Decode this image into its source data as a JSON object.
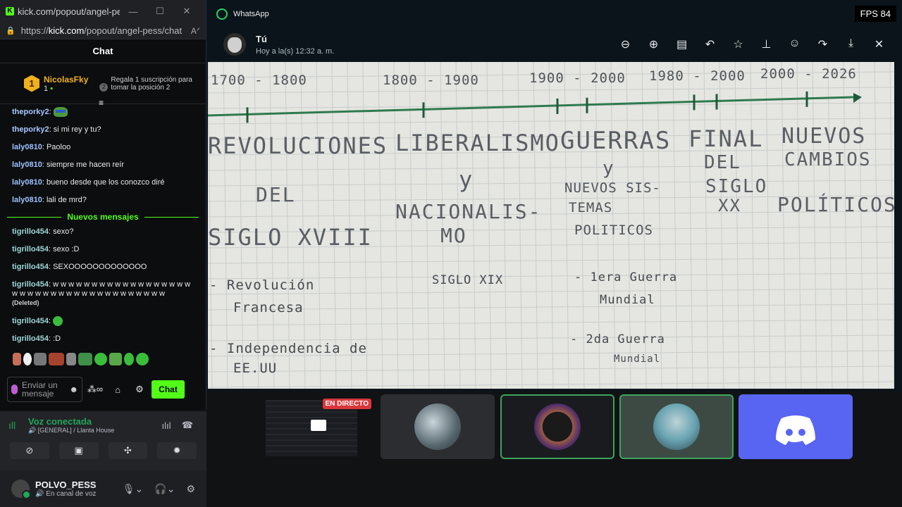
{
  "kick": {
    "tab_title": "kick.com/popout/angel-pes...",
    "url_prefix": "https://",
    "url_host": "kick.com",
    "url_path": "/popout/angel-pess/chat",
    "chat_header": "Chat",
    "top_gifter": {
      "rank": "1",
      "name": "NicolasFky",
      "count": "1"
    },
    "gift_promo": {
      "rank": "2",
      "text": "Regala 1 suscripción para tomar la posición 2"
    },
    "messages_before": [
      {
        "user": "theporky2",
        "text": "",
        "emote": "frog",
        "style": "porky"
      },
      {
        "user": "theporky2",
        "text": "si mi rey y tu?",
        "style": "porky"
      },
      {
        "user": "laly0810",
        "text": "Paoloo",
        "style": "laly"
      },
      {
        "user": "laly0810",
        "text": "siempre me hacen reír",
        "style": "laly"
      },
      {
        "user": "laly0810",
        "text": "bueno desde que los conozco diré",
        "style": "laly"
      },
      {
        "user": "laly0810",
        "text": "lali de mrd?",
        "style": "laly"
      }
    ],
    "new_messages_label": "Nuevos mensajes",
    "messages_after": [
      {
        "user": "tigrillo454",
        "text": "sexo?"
      },
      {
        "user": "tigrillo454",
        "text": "sexo :D"
      },
      {
        "user": "tigrillo454",
        "text": "SEXOOOOOOOOOOOOO"
      },
      {
        "user": "tigrillo454",
        "text": "w w w w w w w w w w w w w w w w w w w w w w w w w w w w w w w w w w w w w w",
        "deleted": "(Deleted)"
      },
      {
        "user": "tigrillo454",
        "text": "",
        "emote": "green"
      },
      {
        "user": "tigrillo454",
        "text": ":D"
      }
    ],
    "input_placeholder": "Enviar un mensaje",
    "chat_button": "Chat"
  },
  "discord": {
    "voice_status": "Voz conectada",
    "voice_channel": "[GENERAL] / Llanta House",
    "user_name": "POLVO_PESS",
    "user_status": "En canal de voz",
    "live_label": "EN DIRECTO"
  },
  "whatsapp": {
    "window_title": "WhatsApp",
    "sender": "Tú",
    "timestamp": "Hoy a la(s) 12:32 a. m.",
    "fps": "FPS 84"
  },
  "photo_text": {
    "periods": [
      "1700 - 1800",
      "1800 - 1900",
      "1900 - 2000",
      "1980 - 2000",
      "2000 - 2026"
    ],
    "h1": "REVOLUCIONES",
    "h1b": "DEL",
    "h1c": "SIGLO XVIII",
    "h2": "LIBERALISMO",
    "h2b": "y",
    "h2c": "NACIONALIS-",
    "h2d": "MO",
    "h3": "GUERRAS",
    "h3b": "y",
    "h3c": "NUEVOS SIS-",
    "h3d": "TEMAS",
    "h3e": "POLITICOS",
    "h4": "FINAL",
    "h4b": "DEL",
    "h4c": "SIGLO",
    "h4d": "XX",
    "h5": "NUEVOS",
    "h5b": "CAMBIOS",
    "h5c": "POLÍTICOS",
    "n1": "- Revolución",
    "n1b": "Francesa",
    "n2": "- Independencia de",
    "n2b": "EE.UU",
    "n3": "SIGLO XIX",
    "n4": "- 1era Guerra",
    "n4b": "Mundial",
    "n5": "- 2da Guerra",
    "n5b": "Mundial"
  }
}
